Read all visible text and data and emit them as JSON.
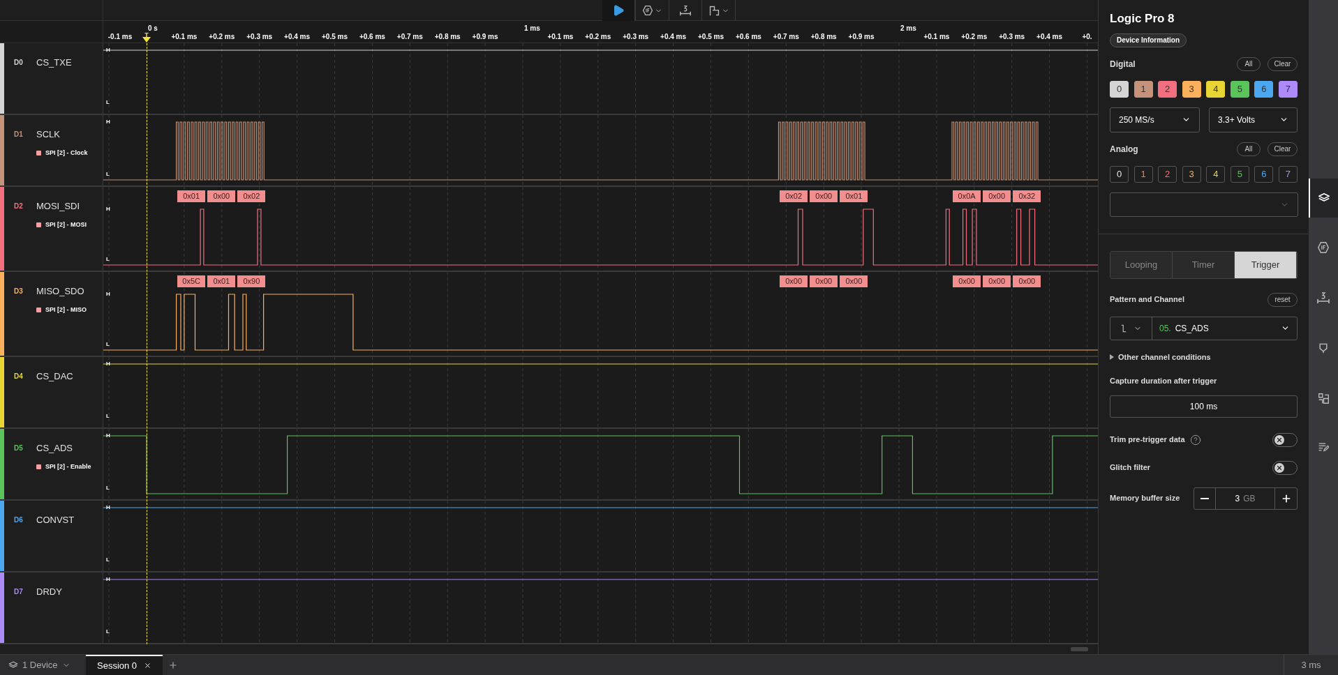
{
  "timeline": {
    "major": [
      "0 s",
      "1 ms",
      "2 ms"
    ],
    "minor": [
      "-0.1 ms",
      "+0.1 ms",
      "+0.2 ms",
      "+0.3 ms",
      "+0.4 ms",
      "+0.5 ms",
      "+0.6 ms",
      "+0.7 ms",
      "+0.8 ms",
      "+0.9 ms",
      "+0.1 ms",
      "+0.2 ms",
      "+0.3 ms",
      "+0.4 ms",
      "+0.5 ms",
      "+0.6 ms",
      "+0.7 ms",
      "+0.8 ms",
      "+0.9 ms",
      "+0.1 ms",
      "+0.2 ms",
      "+0.3 ms",
      "+0.4 ms",
      "+0."
    ],
    "trigger": "T"
  },
  "channels": [
    {
      "index": "D0",
      "name": "CS_TXE",
      "color": "#d4d4d4",
      "high": "H",
      "low": "L"
    },
    {
      "index": "D1",
      "name": "SCLK",
      "color": "#c4937a",
      "high": "H",
      "low": "L",
      "analyzer": "SPI [2] - Clock"
    },
    {
      "index": "D2",
      "name": "MOSI_SDI",
      "color": "#f36f7f",
      "high": "H",
      "low": "L",
      "analyzer": "SPI [2] - MOSI",
      "frames": [
        "0x01",
        "0x00",
        "0x02",
        "0x02",
        "0x00",
        "0x01",
        "0x0A",
        "0x00",
        "0x32"
      ]
    },
    {
      "index": "D3",
      "name": "MISO_SDO",
      "color": "#fbb05c",
      "high": "H",
      "low": "L",
      "analyzer": "SPI [2] - MISO",
      "frames": [
        "0x5C",
        "0x01",
        "0x90",
        "0x00",
        "0x00",
        "0x00",
        "0x00",
        "0x00",
        "0x00"
      ]
    },
    {
      "index": "D4",
      "name": "CS_DAC",
      "color": "#e8d534",
      "high": "H",
      "low": "L"
    },
    {
      "index": "D5",
      "name": "CS_ADS",
      "color": "#5ac45a",
      "high": "H",
      "low": "L",
      "analyzer": "SPI [2] - Enable"
    },
    {
      "index": "D6",
      "name": "CONVST",
      "color": "#4ba8f0",
      "high": "H",
      "low": "L"
    },
    {
      "index": "D7",
      "name": "DRDY",
      "color": "#ac8af7",
      "high": "H",
      "low": "L"
    }
  ],
  "device": {
    "title": "Logic Pro 8",
    "info_button": "Device Information",
    "digital": {
      "label": "Digital",
      "all": "All",
      "clear": "Clear",
      "rate": "250 MS/s",
      "voltage": "3.3+ Volts",
      "channels": [
        {
          "label": "0",
          "color": "#d4d4d4",
          "selected": true
        },
        {
          "label": "1",
          "color": "#c4937a",
          "selected": true
        },
        {
          "label": "2",
          "color": "#f36f7f",
          "selected": true
        },
        {
          "label": "3",
          "color": "#fbb05c",
          "selected": true
        },
        {
          "label": "4",
          "color": "#e8d534",
          "selected": true
        },
        {
          "label": "5",
          "color": "#5ac45a",
          "selected": true
        },
        {
          "label": "6",
          "color": "#4ba8f0",
          "selected": true
        },
        {
          "label": "7",
          "color": "#ac8af7",
          "selected": true
        }
      ]
    },
    "analog": {
      "label": "Analog",
      "all": "All",
      "clear": "Clear",
      "channels": [
        {
          "label": "0",
          "color": "#e6e6e6",
          "selected": false
        },
        {
          "label": "1",
          "color": "#c4937a",
          "selected": false
        },
        {
          "label": "2",
          "color": "#f36f7f",
          "selected": false
        },
        {
          "label": "3",
          "color": "#fbb05c",
          "selected": false
        },
        {
          "label": "4",
          "color": "#e8d534",
          "selected": false
        },
        {
          "label": "5",
          "color": "#5ac45a",
          "selected": false
        },
        {
          "label": "6",
          "color": "#4ba8f0",
          "selected": false
        },
        {
          "label": "7",
          "color": "#ac8af7",
          "selected": false
        }
      ]
    },
    "modes": [
      {
        "label": "Looping",
        "selected": false
      },
      {
        "label": "Timer",
        "selected": false
      },
      {
        "label": "Trigger",
        "selected": true
      }
    ],
    "pattern": {
      "label": "Pattern and Channel",
      "reset": "reset",
      "channel_number": "05.",
      "channel_name": "CS_ADS"
    },
    "other_conditions": {
      "label": "Other channel conditions",
      "expanded": false
    },
    "capture": {
      "label": "Capture duration after trigger",
      "value": "100 ms"
    },
    "trim": {
      "label": "Trim pre-trigger data",
      "on": false
    },
    "glitch": {
      "label": "Glitch filter",
      "on": false
    },
    "memory": {
      "label": "Memory buffer size",
      "value": "3",
      "unit": "GB"
    }
  },
  "bottom": {
    "device": "1 Device",
    "sessions": [
      {
        "label": "Session 0",
        "selected": true
      }
    ],
    "zoom": "3 ms"
  }
}
